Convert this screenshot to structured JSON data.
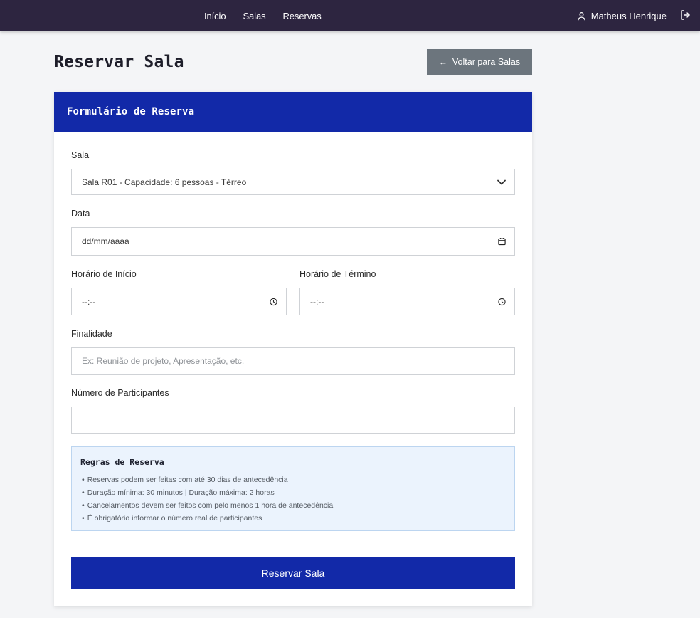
{
  "nav": {
    "links": [
      "Início",
      "Salas",
      "Reservas"
    ],
    "user_name": "Matheus Henrique",
    "user_icon": "user-icon",
    "logout_icon": "logout-icon"
  },
  "header": {
    "title": "Reservar Sala",
    "back_label": "Voltar para Salas",
    "back_icon": "arrow-left-icon"
  },
  "form": {
    "title": "Formulário de Reserva",
    "room": {
      "label": "Sala",
      "value": "Sala R01 - Capacidade: 6 pessoas - Térreo"
    },
    "date": {
      "label": "Data",
      "placeholder": "dd/mm/aaaa"
    },
    "start_time": {
      "label": "Horário de Início",
      "placeholder": "--:--"
    },
    "end_time": {
      "label": "Horário de Término",
      "placeholder": "--:--"
    },
    "purpose": {
      "label": "Finalidade",
      "placeholder": "Ex: Reunião de projeto, Apresentação, etc."
    },
    "participants": {
      "label": "Número de Participantes",
      "value": ""
    },
    "rules": {
      "title": "Regras de Reserva",
      "items": [
        "Reservas podem ser feitas com até 30 dias de antecedência",
        "Duração mínima: 30 minutos | Duração máxima: 2 horas",
        "Cancelamentos devem ser feitos com pelo menos 1 hora de antecedência",
        "É obrigatório informar o número real de participantes"
      ]
    },
    "submit_label": "Reservar Sala"
  },
  "colors": {
    "navbar": "#2d2540",
    "primary": "#1229a8",
    "secondary_button": "#6c757d",
    "rules_bg": "#ebf3fd",
    "page_bg": "#f4f5f7"
  }
}
